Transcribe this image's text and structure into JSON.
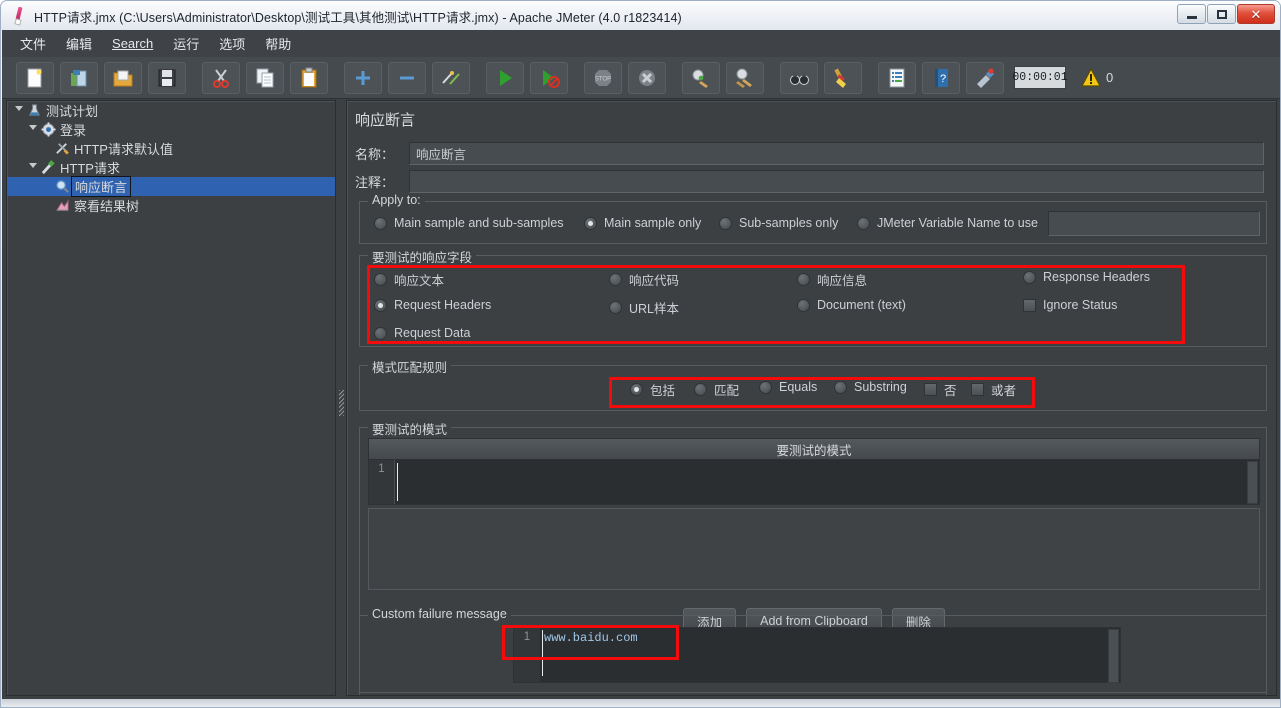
{
  "window": {
    "title": "HTTP请求.jmx (C:\\Users\\Administrator\\Desktop\\测试工具\\其他测试\\HTTP请求.jmx) - Apache JMeter (4.0 r1823414)",
    "app_icon": "pencil-icon",
    "controls": {
      "minimize": "–",
      "maximize": "□",
      "close": "✕"
    }
  },
  "menubar": {
    "items": [
      {
        "label": "文件",
        "mnemonic": ""
      },
      {
        "label": "编辑",
        "mnemonic": ""
      },
      {
        "label": "Search",
        "mnemonic": "S"
      },
      {
        "label": "运行",
        "mnemonic": ""
      },
      {
        "label": "选项",
        "mnemonic": ""
      },
      {
        "label": "帮助",
        "mnemonic": ""
      }
    ]
  },
  "toolbar": {
    "buttons": [
      {
        "name": "new-icon"
      },
      {
        "name": "templates-icon"
      },
      {
        "name": "open-icon"
      },
      {
        "name": "save-icon"
      },
      {
        "name": "cut-icon"
      },
      {
        "name": "copy-icon"
      },
      {
        "name": "paste-icon"
      },
      {
        "name": "expand-all-icon"
      },
      {
        "name": "collapse-all-icon"
      },
      {
        "name": "toggle-icon"
      },
      {
        "name": "start-icon"
      },
      {
        "name": "start-no-timers-icon"
      },
      {
        "name": "stop-icon"
      },
      {
        "name": "shutdown-icon"
      },
      {
        "name": "clear-icon"
      },
      {
        "name": "clear-all-icon"
      },
      {
        "name": "search-icon"
      },
      {
        "name": "search-reset-icon"
      },
      {
        "name": "function-helper-icon"
      },
      {
        "name": "help-icon"
      },
      {
        "name": "undo-redo-icon"
      }
    ],
    "timer": "00:00:01",
    "warning_icon": "warning-triangle-icon",
    "warning_count": "0"
  },
  "tree": {
    "nodes": [
      {
        "label": "测试计划",
        "icon": "test-plan-icon",
        "indent": 0,
        "twisty": "open",
        "selected": false
      },
      {
        "label": "登录",
        "icon": "thread-group-icon",
        "indent": 1,
        "twisty": "open",
        "selected": false
      },
      {
        "label": "HTTP请求默认值",
        "icon": "http-defaults-icon",
        "indent": 2,
        "twisty": "none",
        "selected": false
      },
      {
        "label": "HTTP请求",
        "icon": "http-sampler-icon",
        "indent": 2,
        "twisty": "open",
        "selected": false
      },
      {
        "label": "响应断言",
        "icon": "assertion-icon",
        "indent": 3,
        "twisty": "none",
        "selected": true
      },
      {
        "label": "察看结果树",
        "icon": "view-results-tree-icon",
        "indent": 3,
        "twisty": "none",
        "selected": false
      }
    ]
  },
  "panel": {
    "title": "响应断言",
    "name_label": "名称：",
    "name_value": "响应断言",
    "comment_label": "注释：",
    "comment_value": "",
    "apply_to": {
      "title": "Apply to:",
      "options": [
        {
          "label": "Main sample and sub-samples",
          "selected": false
        },
        {
          "label": "Main sample only",
          "selected": true
        },
        {
          "label": "Sub-samples only",
          "selected": false
        },
        {
          "label": "JMeter Variable Name to use",
          "selected": false
        }
      ],
      "variable_value": ""
    },
    "response_field": {
      "title": "要测试的响应字段",
      "options": [
        {
          "label": "响应文本",
          "type": "radio",
          "selected": false
        },
        {
          "label": "响应代码",
          "type": "radio",
          "selected": false
        },
        {
          "label": "响应信息",
          "type": "radio",
          "selected": false
        },
        {
          "label": "Response Headers",
          "type": "radio",
          "selected": false
        },
        {
          "label": "Request Headers",
          "type": "radio",
          "selected": true
        },
        {
          "label": "URL样本",
          "type": "radio",
          "selected": false
        },
        {
          "label": "Document (text)",
          "type": "radio",
          "selected": false
        },
        {
          "label": "Ignore Status",
          "type": "checkbox",
          "selected": false
        },
        {
          "label": "Request Data",
          "type": "radio",
          "selected": false
        }
      ]
    },
    "pattern_rules": {
      "title": "模式匹配规则",
      "options": [
        {
          "label": "包括",
          "type": "radio",
          "selected": true
        },
        {
          "label": "匹配",
          "type": "radio",
          "selected": false
        },
        {
          "label": "Equals",
          "type": "radio",
          "selected": false
        },
        {
          "label": "Substring",
          "type": "radio",
          "selected": false
        },
        {
          "label": "否",
          "type": "checkbox",
          "selected": false
        },
        {
          "label": "或者",
          "type": "checkbox",
          "selected": false
        }
      ]
    },
    "patterns": {
      "title": "要测试的模式",
      "column_header": "要测试的模式",
      "rows": [
        {
          "num": "1",
          "value": ""
        }
      ]
    },
    "buttons": {
      "add": "添加",
      "add_from_clipboard": "Add from Clipboard",
      "delete": "删除"
    },
    "custom_failure": {
      "title": "Custom failure message",
      "lines": [
        {
          "num": "1",
          "text": "www.baidu.com"
        }
      ]
    }
  },
  "highlight_color": "#f40b0b"
}
